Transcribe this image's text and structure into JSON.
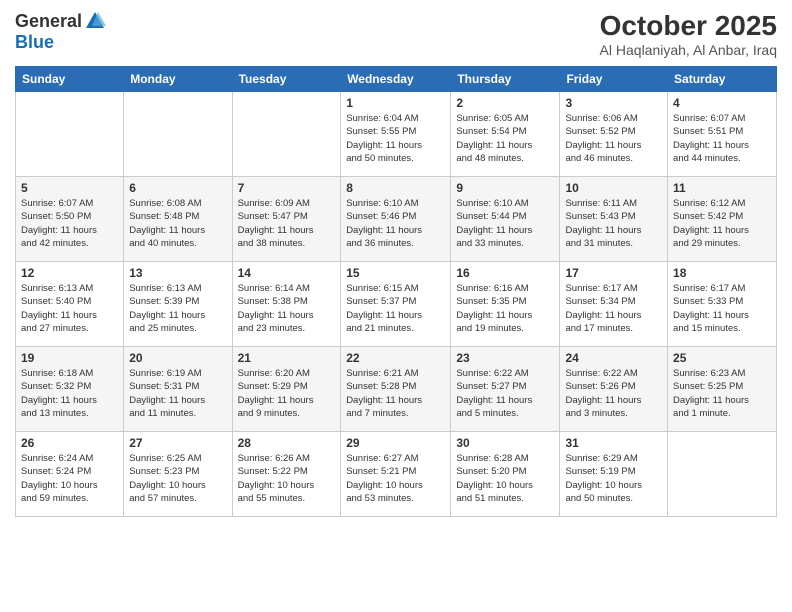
{
  "header": {
    "logo_general": "General",
    "logo_blue": "Blue",
    "month_title": "October 2025",
    "location": "Al Haqlaniyah, Al Anbar, Iraq"
  },
  "weekdays": [
    "Sunday",
    "Monday",
    "Tuesday",
    "Wednesday",
    "Thursday",
    "Friday",
    "Saturday"
  ],
  "weeks": [
    [
      {
        "day": "",
        "info": ""
      },
      {
        "day": "",
        "info": ""
      },
      {
        "day": "",
        "info": ""
      },
      {
        "day": "1",
        "info": "Sunrise: 6:04 AM\nSunset: 5:55 PM\nDaylight: 11 hours\nand 50 minutes."
      },
      {
        "day": "2",
        "info": "Sunrise: 6:05 AM\nSunset: 5:54 PM\nDaylight: 11 hours\nand 48 minutes."
      },
      {
        "day": "3",
        "info": "Sunrise: 6:06 AM\nSunset: 5:52 PM\nDaylight: 11 hours\nand 46 minutes."
      },
      {
        "day": "4",
        "info": "Sunrise: 6:07 AM\nSunset: 5:51 PM\nDaylight: 11 hours\nand 44 minutes."
      }
    ],
    [
      {
        "day": "5",
        "info": "Sunrise: 6:07 AM\nSunset: 5:50 PM\nDaylight: 11 hours\nand 42 minutes."
      },
      {
        "day": "6",
        "info": "Sunrise: 6:08 AM\nSunset: 5:48 PM\nDaylight: 11 hours\nand 40 minutes."
      },
      {
        "day": "7",
        "info": "Sunrise: 6:09 AM\nSunset: 5:47 PM\nDaylight: 11 hours\nand 38 minutes."
      },
      {
        "day": "8",
        "info": "Sunrise: 6:10 AM\nSunset: 5:46 PM\nDaylight: 11 hours\nand 36 minutes."
      },
      {
        "day": "9",
        "info": "Sunrise: 6:10 AM\nSunset: 5:44 PM\nDaylight: 11 hours\nand 33 minutes."
      },
      {
        "day": "10",
        "info": "Sunrise: 6:11 AM\nSunset: 5:43 PM\nDaylight: 11 hours\nand 31 minutes."
      },
      {
        "day": "11",
        "info": "Sunrise: 6:12 AM\nSunset: 5:42 PM\nDaylight: 11 hours\nand 29 minutes."
      }
    ],
    [
      {
        "day": "12",
        "info": "Sunrise: 6:13 AM\nSunset: 5:40 PM\nDaylight: 11 hours\nand 27 minutes."
      },
      {
        "day": "13",
        "info": "Sunrise: 6:13 AM\nSunset: 5:39 PM\nDaylight: 11 hours\nand 25 minutes."
      },
      {
        "day": "14",
        "info": "Sunrise: 6:14 AM\nSunset: 5:38 PM\nDaylight: 11 hours\nand 23 minutes."
      },
      {
        "day": "15",
        "info": "Sunrise: 6:15 AM\nSunset: 5:37 PM\nDaylight: 11 hours\nand 21 minutes."
      },
      {
        "day": "16",
        "info": "Sunrise: 6:16 AM\nSunset: 5:35 PM\nDaylight: 11 hours\nand 19 minutes."
      },
      {
        "day": "17",
        "info": "Sunrise: 6:17 AM\nSunset: 5:34 PM\nDaylight: 11 hours\nand 17 minutes."
      },
      {
        "day": "18",
        "info": "Sunrise: 6:17 AM\nSunset: 5:33 PM\nDaylight: 11 hours\nand 15 minutes."
      }
    ],
    [
      {
        "day": "19",
        "info": "Sunrise: 6:18 AM\nSunset: 5:32 PM\nDaylight: 11 hours\nand 13 minutes."
      },
      {
        "day": "20",
        "info": "Sunrise: 6:19 AM\nSunset: 5:31 PM\nDaylight: 11 hours\nand 11 minutes."
      },
      {
        "day": "21",
        "info": "Sunrise: 6:20 AM\nSunset: 5:29 PM\nDaylight: 11 hours\nand 9 minutes."
      },
      {
        "day": "22",
        "info": "Sunrise: 6:21 AM\nSunset: 5:28 PM\nDaylight: 11 hours\nand 7 minutes."
      },
      {
        "day": "23",
        "info": "Sunrise: 6:22 AM\nSunset: 5:27 PM\nDaylight: 11 hours\nand 5 minutes."
      },
      {
        "day": "24",
        "info": "Sunrise: 6:22 AM\nSunset: 5:26 PM\nDaylight: 11 hours\nand 3 minutes."
      },
      {
        "day": "25",
        "info": "Sunrise: 6:23 AM\nSunset: 5:25 PM\nDaylight: 11 hours\nand 1 minute."
      }
    ],
    [
      {
        "day": "26",
        "info": "Sunrise: 6:24 AM\nSunset: 5:24 PM\nDaylight: 10 hours\nand 59 minutes."
      },
      {
        "day": "27",
        "info": "Sunrise: 6:25 AM\nSunset: 5:23 PM\nDaylight: 10 hours\nand 57 minutes."
      },
      {
        "day": "28",
        "info": "Sunrise: 6:26 AM\nSunset: 5:22 PM\nDaylight: 10 hours\nand 55 minutes."
      },
      {
        "day": "29",
        "info": "Sunrise: 6:27 AM\nSunset: 5:21 PM\nDaylight: 10 hours\nand 53 minutes."
      },
      {
        "day": "30",
        "info": "Sunrise: 6:28 AM\nSunset: 5:20 PM\nDaylight: 10 hours\nand 51 minutes."
      },
      {
        "day": "31",
        "info": "Sunrise: 6:29 AM\nSunset: 5:19 PM\nDaylight: 10 hours\nand 50 minutes."
      },
      {
        "day": "",
        "info": ""
      }
    ]
  ]
}
